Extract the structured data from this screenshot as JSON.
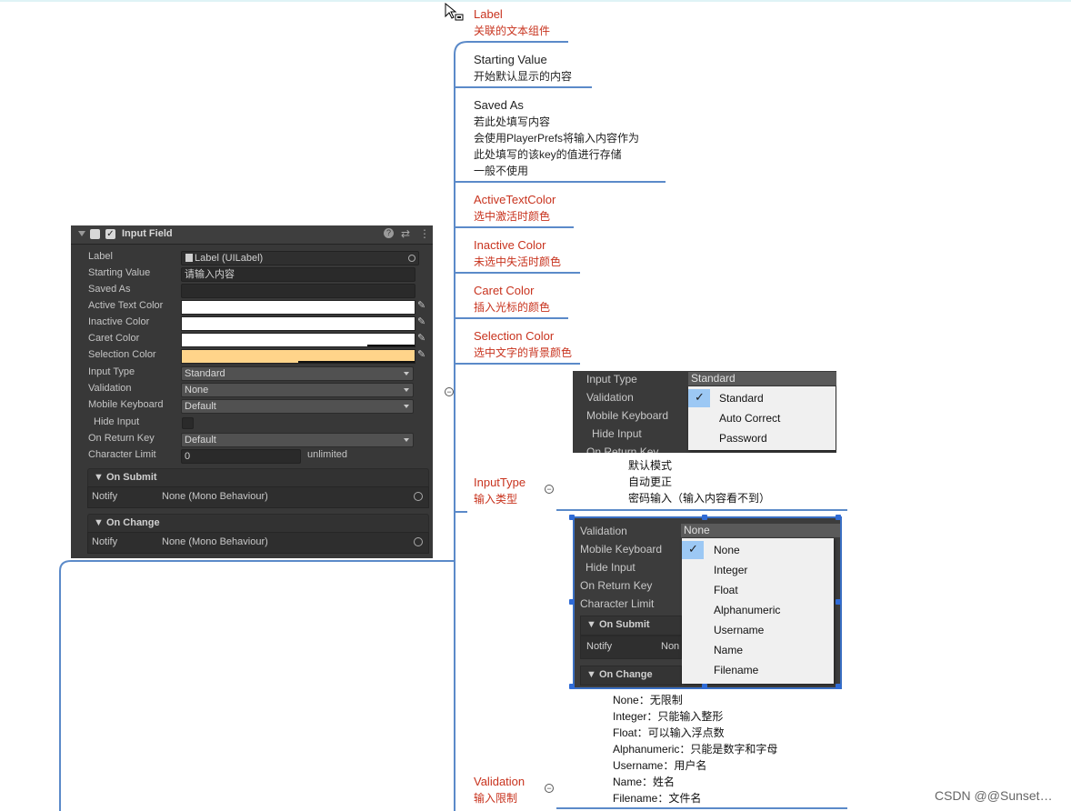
{
  "nodes": {
    "label": {
      "title": "Label",
      "desc": "关联的文本组件"
    },
    "starting": {
      "title": "Starting Value",
      "desc": "开始默认显示的内容"
    },
    "saved": {
      "title": "Saved As",
      "l1": "若此处填写内容",
      "l2": "会使用PlayerPrefs将输入内容作为",
      "l3": "此处填写的该key的值进行存储",
      "l4": "一般不使用"
    },
    "activetext": {
      "title": "ActiveTextColor",
      "desc": "选中激活时颜色"
    },
    "inactive": {
      "title": "Inactive Color",
      "desc": "未选中失活时颜色"
    },
    "caret": {
      "title": "Caret Color",
      "desc": "插入光标的颜色"
    },
    "selection": {
      "title": "Selection Color",
      "desc": "选中文字的背景颜色"
    },
    "inputtype": {
      "title": "InputType",
      "desc": "输入类型"
    },
    "validation": {
      "title": "Validation",
      "desc": "输入限制"
    }
  },
  "inputtype_notes": [
    "默认模式",
    "自动更正",
    "密码输入（输入内容看不到）"
  ],
  "validation_notes": [
    "None：无限制",
    "Integer：只能输入整形",
    "Float：可以输入浮点数",
    "Alphanumeric：只能是数字和字母",
    "Username：用户名",
    "Name：姓名",
    "Filename：文件名"
  ],
  "inspector": {
    "title": "Input Field",
    "fields": {
      "label": {
        "name": "Label",
        "value": "Label (UILabel)"
      },
      "starting": {
        "name": "Starting Value",
        "value": "请输入内容"
      },
      "saved": {
        "name": "Saved As",
        "value": ""
      },
      "active": {
        "name": "Active Text Color"
      },
      "inactive": {
        "name": "Inactive Color"
      },
      "caret": {
        "name": "Caret Color"
      },
      "selection": {
        "name": "Selection Color"
      },
      "inputtype": {
        "name": "Input Type",
        "value": "Standard"
      },
      "validation": {
        "name": "Validation",
        "value": "None"
      },
      "keyboard": {
        "name": "Mobile Keyboard",
        "value": "Default"
      },
      "hide": {
        "name": "Hide Input"
      },
      "onreturn": {
        "name": "On Return Key",
        "value": "Default"
      },
      "charlimit": {
        "name": "Character Limit",
        "value": "0",
        "suffix": "unlimited"
      }
    },
    "onsubmit": {
      "header": "▼ On Submit",
      "notify": "Notify",
      "value": "None (Mono Behaviour)"
    },
    "onchange": {
      "header": "▼ On Change",
      "notify": "Notify",
      "value": "None (Mono Behaviour)"
    },
    "colors": {
      "selection": "#ffd48a",
      "field_white": "#ffffff"
    }
  },
  "popup_inputtype": {
    "labels": [
      "Input Type",
      "Validation",
      "Mobile Keyboard",
      "Hide Input",
      "On Return Key"
    ],
    "selected": "Standard",
    "options": [
      "Standard",
      "Auto Correct",
      "Password"
    ]
  },
  "popup_validation": {
    "labels": [
      "Validation",
      "Mobile Keyboard",
      "Hide Input",
      "On Return Key",
      "Character Limit"
    ],
    "selected": "None",
    "events": [
      "▼ On Submit",
      "Notify",
      "Non",
      "▼ On Change"
    ],
    "options": [
      "None",
      "Integer",
      "Float",
      "Alphanumeric",
      "Username",
      "Name",
      "Filename"
    ]
  },
  "watermark": "CSDN @@Sunset…"
}
